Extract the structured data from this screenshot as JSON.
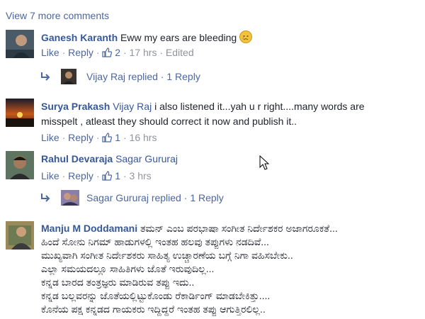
{
  "view_more": "View 7 more comments",
  "sep": "·",
  "comments": [
    {
      "author": "Ganesh Karanth",
      "mention": "",
      "text": "Eww my ears are bleeding",
      "emoji": "crying-face-emoji",
      "like": "Like",
      "reply": "Reply",
      "likes": "2",
      "time": "17 hrs",
      "edited": "Edited",
      "replied": {
        "text": "Vijay Raj replied",
        "count": "1 Reply"
      }
    },
    {
      "author": "Surya Prakash",
      "mention": "Vijay Raj",
      "text_line1": "i also listened it...yah u r right....many words are",
      "text_line2": "misspelt , atleast they should correct it now and publish it..",
      "like": "Like",
      "reply": "Reply",
      "likes": "1",
      "time": "16 hrs"
    },
    {
      "author": "Rahul Devaraja",
      "mention": "Sagar Gururaj",
      "like": "Like",
      "reply": "Reply",
      "likes": "1",
      "time": "3 hrs",
      "replied": {
        "text": "Sagar Gururaj replied",
        "count": "1 Reply"
      }
    },
    {
      "author": "Manju M Doddamani",
      "lines": [
        "ತಮನ್ ಎಂಬ ಪರಭಾಷಾ ಸಂಗೀತ ನಿರ್ದೇಶಕರ ಅಜಾಗರೂಕತೆ...",
        "ಹಿಂದೆ ಸೋನು ನಿಗಮ್ ಹಾಡುಗಳಲ್ಲಿ ಇಂತಹ ಹಲವು ತಪ್ಪುಗಳು ನಡದಿವೆ...",
        "ಮುಖ್ಯವಾಗಿ ಸಂಗೀತ ನಿರ್ದೇಶಕರು ಸಾಹಿತ್ಯ ಉಚ್ಚಾರಣೆಯ ಬಗ್ಗೆ ನಿಗಾ ವಹಿಸಬೇಕು..",
        "ಎಲ್ಲಾ ಸಮಯದಲ್ಲೂ ಸಾಹಿತಿಗಳು ಜೊತೆ ಇರುವುದಿಲ್ಲ...",
        "ಕನ್ನಡ ಬಾರದ ತಂತ್ರಜ್ಞರು ಮಾಡಿರುವ ತಪ್ಪು ಇದು..",
        "ಕನ್ನಡ ಬಲ್ಲವರನ್ನು ಜೊತೆಯಲ್ಲಿಟ್ಟುಕೊಂಡು ರೆಕಾರ್ಡಿಂಗ್ ಮಾಡಬೇಕಿತ್ತು....",
        "ಕೊನೆಯ ಪಕ್ಷ ಕನ್ನಡದ ಗಾಯಕರು ಇದ್ದಿದ್ದರೆ ಇಂತಹ ತಪ್ಪು ಆಗುತ್ತಿರಲಿಲ್ಲ.."
      ]
    }
  ],
  "colors": {
    "link": "#4b67a1",
    "author": "#365899",
    "meta": "#90949c",
    "text": "#1d2129"
  }
}
